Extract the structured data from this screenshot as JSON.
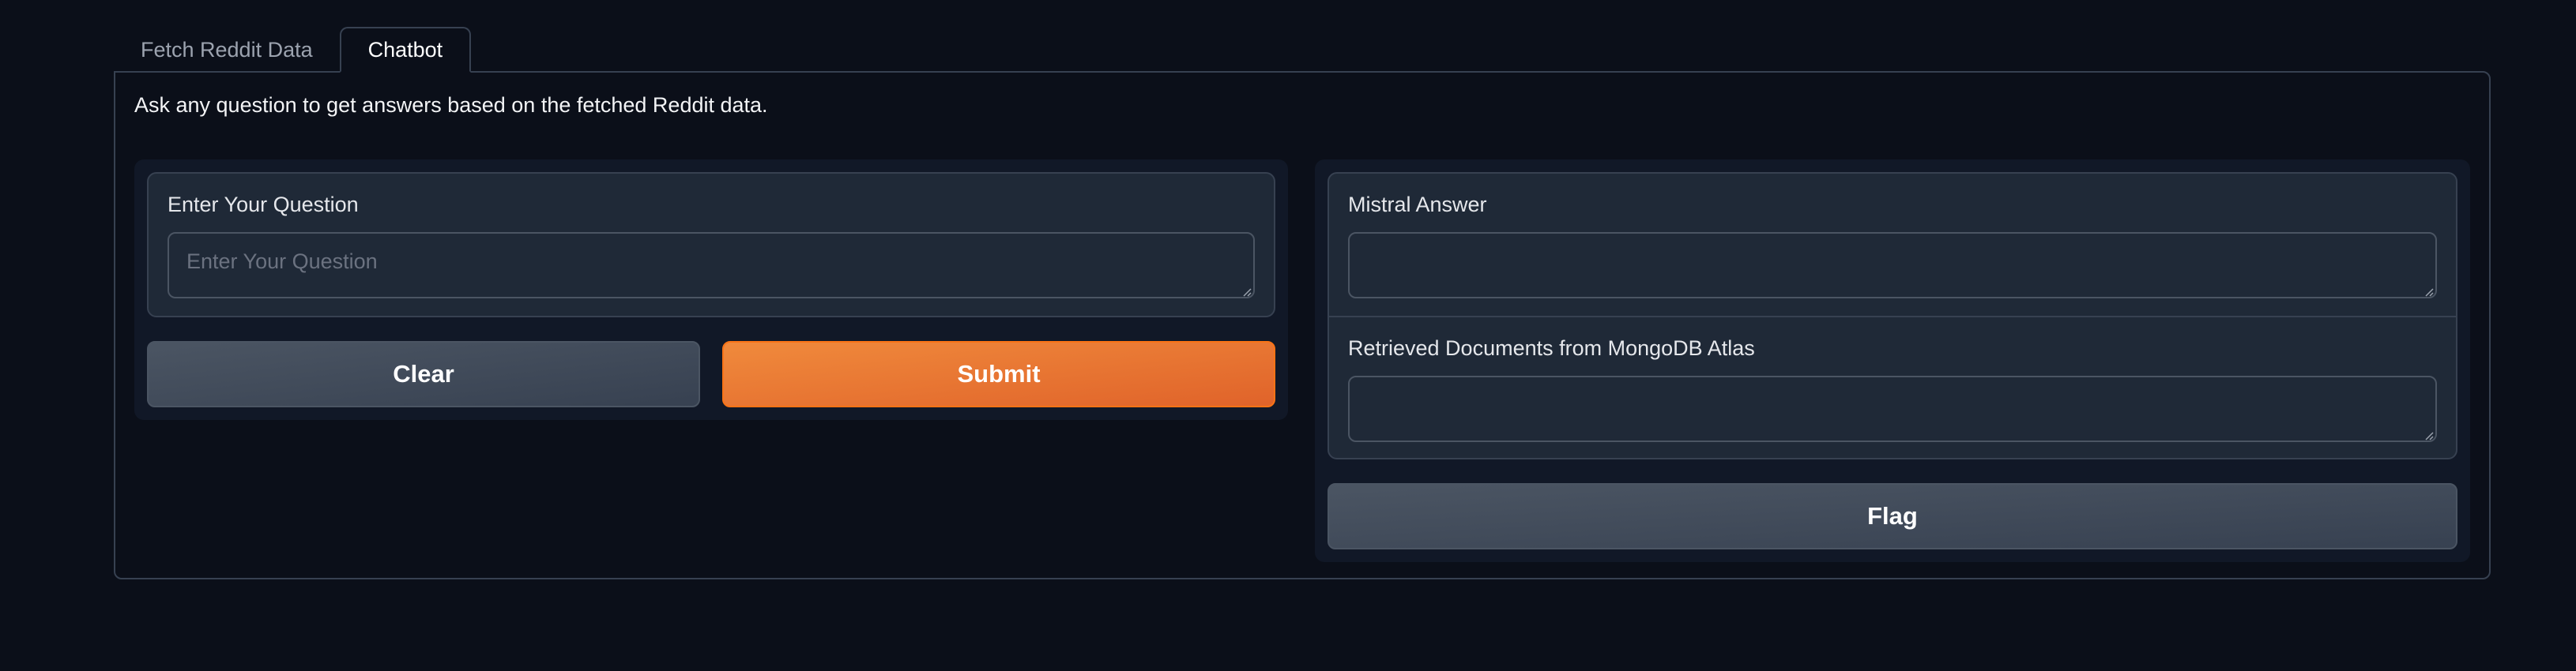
{
  "tabs": [
    {
      "label": "Fetch Reddit Data",
      "active": false
    },
    {
      "label": "Chatbot",
      "active": true
    }
  ],
  "description": "Ask any question to get answers based on the fetched Reddit data.",
  "question": {
    "label": "Enter Your Question",
    "placeholder": "Enter Your Question",
    "value": ""
  },
  "buttons": {
    "clear": "Clear",
    "submit": "Submit",
    "flag": "Flag"
  },
  "outputs": {
    "answer_label": "Mistral Answer",
    "answer_value": "",
    "docs_label": "Retrieved Documents from MongoDB Atlas",
    "docs_value": ""
  },
  "colors": {
    "background": "#0b0f19",
    "primary": "#e8733a",
    "secondary": "#4b5563"
  }
}
